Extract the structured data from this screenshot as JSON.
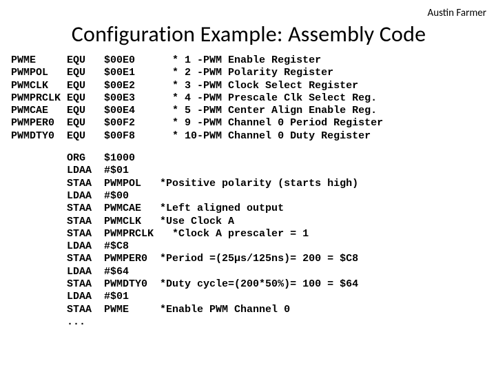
{
  "author": "Austin Farmer",
  "title": "Configuration Example: Assembly Code",
  "equ_table": {
    "rows": [
      {
        "sym": "PWME",
        "op": "EQU",
        "val": "$00E0",
        "star": "*",
        "num": "1",
        "desc": "-PWM Enable Register"
      },
      {
        "sym": "PWMPOL",
        "op": "EQU",
        "val": "$00E1",
        "star": "*",
        "num": "2",
        "desc": "-PWM Polarity Register"
      },
      {
        "sym": "PWMCLK",
        "op": "EQU",
        "val": "$00E2",
        "star": "*",
        "num": "3",
        "desc": "-PWM Clock Select Register"
      },
      {
        "sym": "PWMPRCLK",
        "op": "EQU",
        "val": "$00E3",
        "star": "*",
        "num": "4",
        "desc": "-PWM Prescale Clk Select Reg."
      },
      {
        "sym": "PWMCAE",
        "op": "EQU",
        "val": "$00E4",
        "star": "*",
        "num": "5",
        "desc": "-PWM Center Align Enable Reg."
      },
      {
        "sym": "PWMPER0",
        "op": "EQU",
        "val": "$00F2",
        "star": "*",
        "num": "9",
        "desc": "-PWM Channel 0 Period Register"
      },
      {
        "sym": "PWMDTY0",
        "op": "EQU",
        "val": "$00F8",
        "star": "*",
        "num": "10",
        "desc": "-PWM Channel 0 Duty Register"
      }
    ]
  },
  "code_lines": [
    {
      "op": "ORG",
      "arg": "$1000",
      "comment": ""
    },
    {
      "op": "LDAA",
      "arg": "#$01",
      "comment": ""
    },
    {
      "op": "STAA",
      "arg": "PWMPOL",
      "comment": "*Positive polarity (starts high)"
    },
    {
      "op": "LDAA",
      "arg": "#$00",
      "comment": ""
    },
    {
      "op": "STAA",
      "arg": "PWMCAE",
      "comment": "*Left aligned output"
    },
    {
      "op": "STAA",
      "arg": "PWMCLK",
      "comment": "*Use Clock A"
    },
    {
      "op": "STAA",
      "arg": "PWMPRCLK",
      "comment": "  *Clock A prescaler = 1"
    },
    {
      "op": "LDAA",
      "arg": "#$C8",
      "comment": ""
    },
    {
      "op": "STAA",
      "arg": "PWMPER0",
      "comment": "*Period =(25µs/125ns)= 200 = $C8"
    },
    {
      "op": "LDAA",
      "arg": "#$64",
      "comment": ""
    },
    {
      "op": "STAA",
      "arg": "PWMDTY0",
      "comment": "*Duty cycle=(200*50%)= 100 = $64"
    },
    {
      "op": "LDAA",
      "arg": "#$01",
      "comment": ""
    },
    {
      "op": "STAA",
      "arg": "PWME",
      "comment": "*Enable PWM Channel 0"
    },
    {
      "op": "...",
      "arg": "",
      "comment": ""
    }
  ]
}
